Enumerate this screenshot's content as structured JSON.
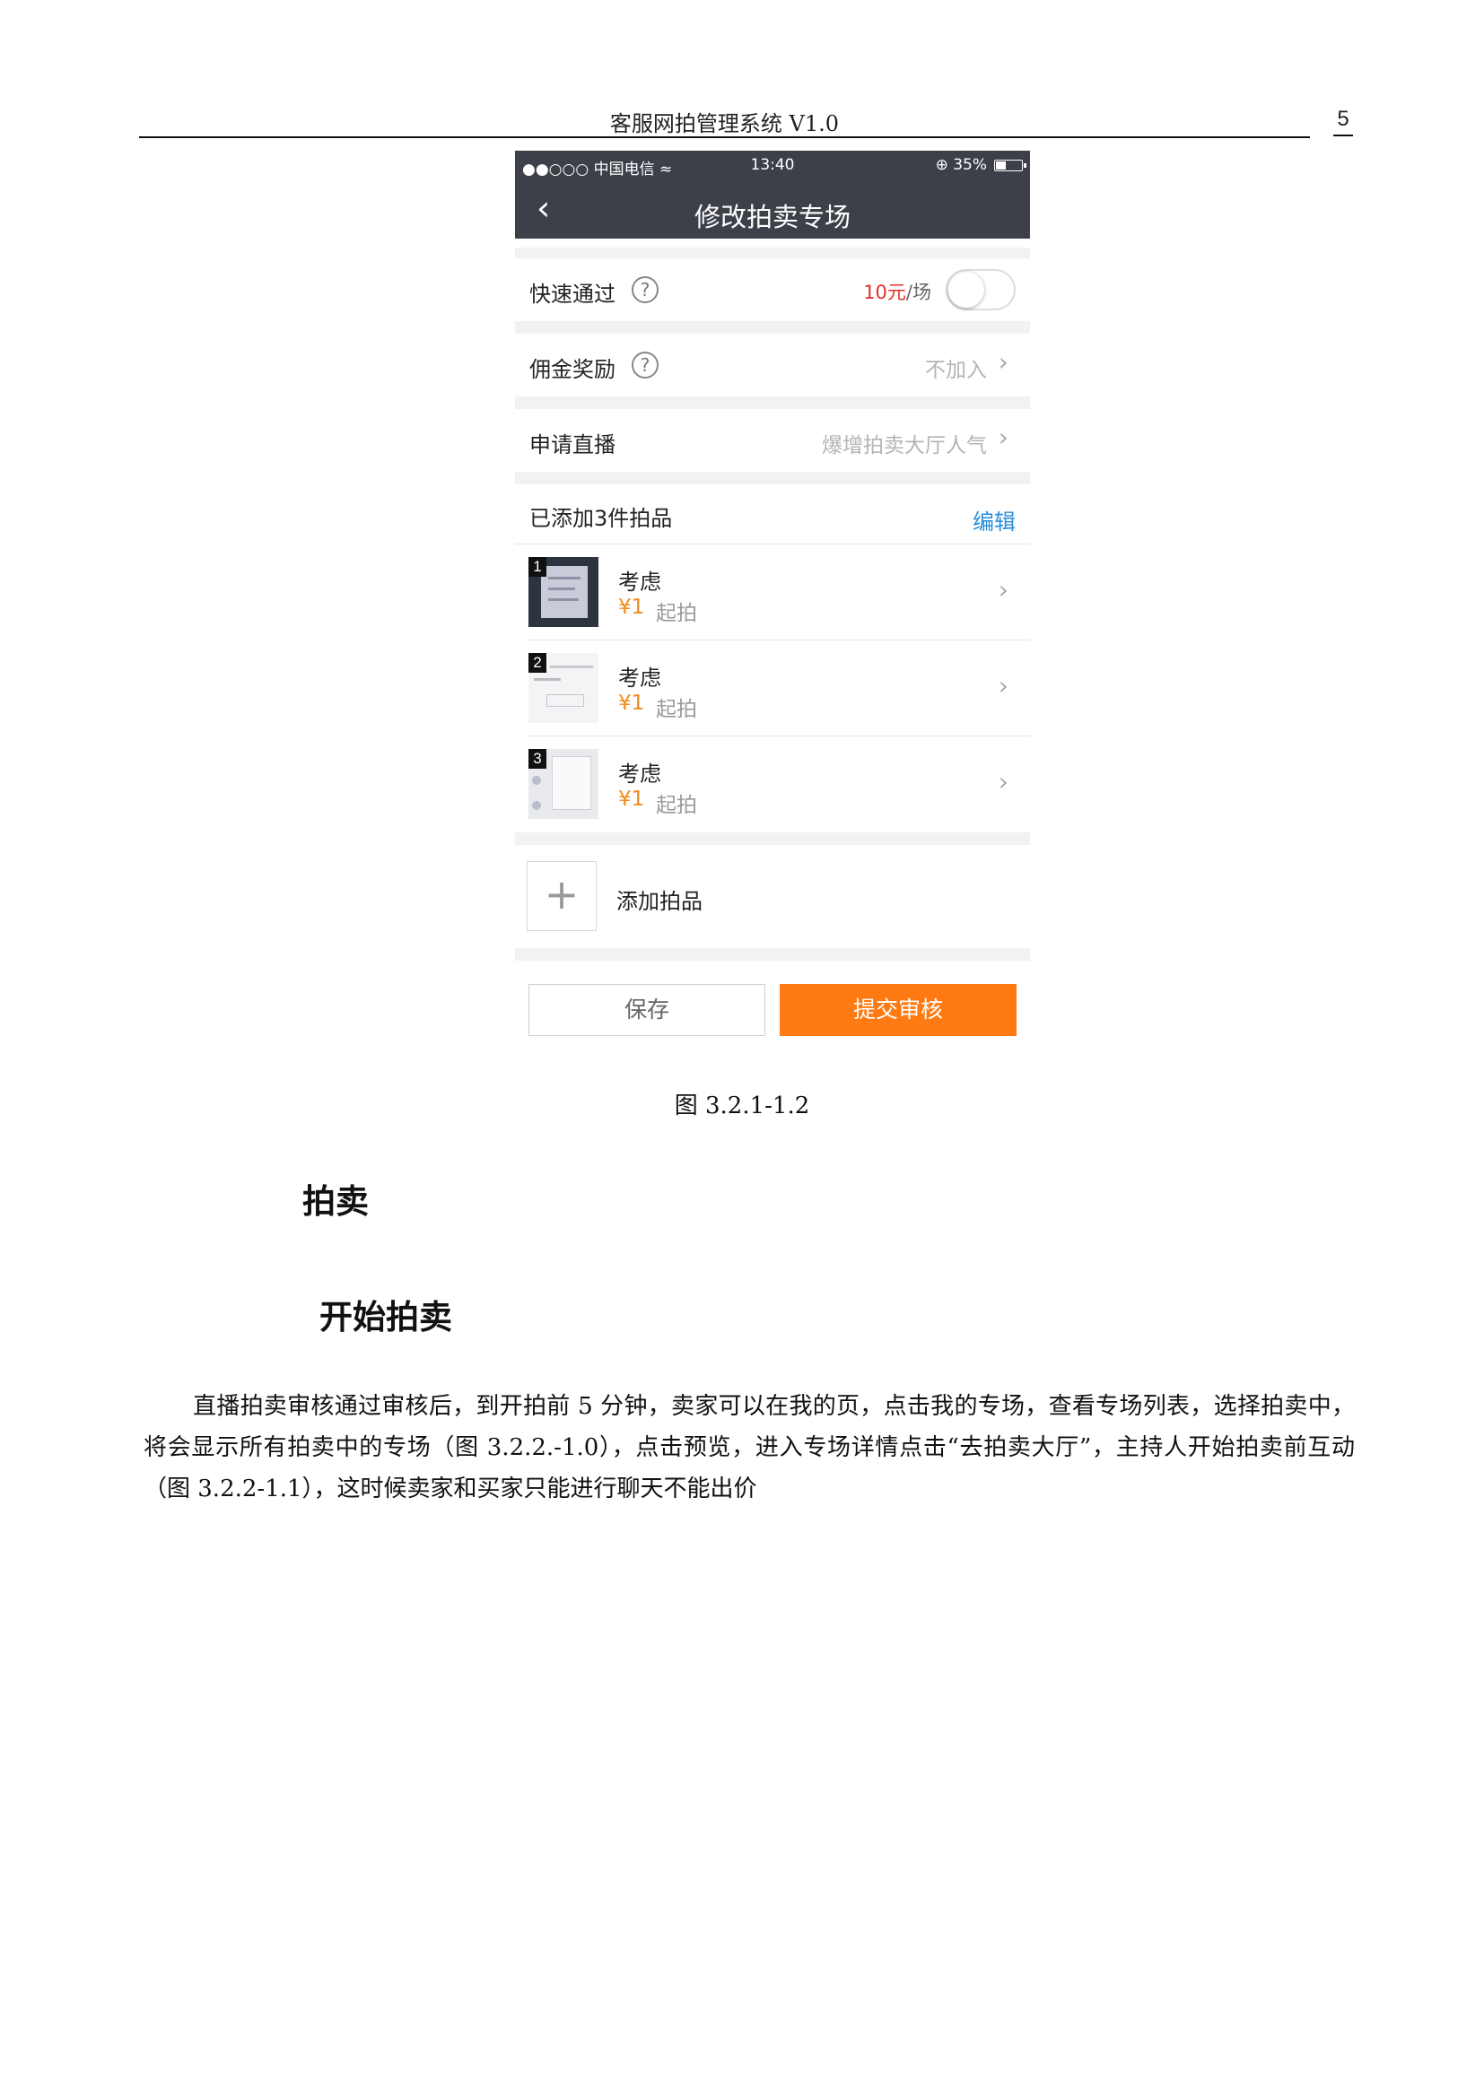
{
  "doc": {
    "header_title": "客服网拍管理系统 V1.0",
    "page_number": "5"
  },
  "phone": {
    "status": {
      "carrier": "●●○○○ 中国电信 ≈",
      "time": "13:40",
      "battery": "⊕ 35%",
      "battery_level": 0.35
    },
    "nav": {
      "back": "‹",
      "title": "修改拍卖专场"
    },
    "rows": {
      "fast_pass": {
        "label": "快速通过",
        "help": "?",
        "price": "10元",
        "unit": "/场"
      },
      "commission": {
        "label": "佣金奖励",
        "help": "?",
        "value": "不加入"
      },
      "live": {
        "label": "申请直播",
        "value": "爆增拍卖大厅人气"
      }
    },
    "items_header": {
      "label": "已添加3件拍品",
      "edit": "编辑"
    },
    "items": [
      {
        "index": "1",
        "name": "考虑",
        "price": "¥1",
        "start": "起拍"
      },
      {
        "index": "2",
        "name": "考虑",
        "price": "¥1",
        "start": "起拍"
      },
      {
        "index": "3",
        "name": "考虑",
        "price": "¥1",
        "start": "起拍"
      }
    ],
    "add_item": {
      "icon": "+",
      "label": "添加拍品"
    },
    "buttons": {
      "save": "保存",
      "submit": "提交审核"
    }
  },
  "caption": "图 3.2.1-1.2",
  "section_heading": "拍卖",
  "subsection_heading": "开始拍卖",
  "paragraph": "直播拍卖审核通过审核后，到开拍前 5 分钟，卖家可以在我的页，点击我的专场，查看专场列表，选择拍卖中，将会显示所有拍卖中的专场（图 3.2.2.-1.0），点击预览，进入专场详情点击“去拍卖大厅”，主持人开始拍卖前互动（图 3.2.2-1.1），这时候卖家和买家只能进行聊天不能出价",
  "colors": {
    "nav_bg": "#3e4049",
    "accent_orange": "#ff7a12",
    "price_red": "#e0322b",
    "edit_blue": "#2a8fdc",
    "item_price_orange": "#f08a1c"
  }
}
